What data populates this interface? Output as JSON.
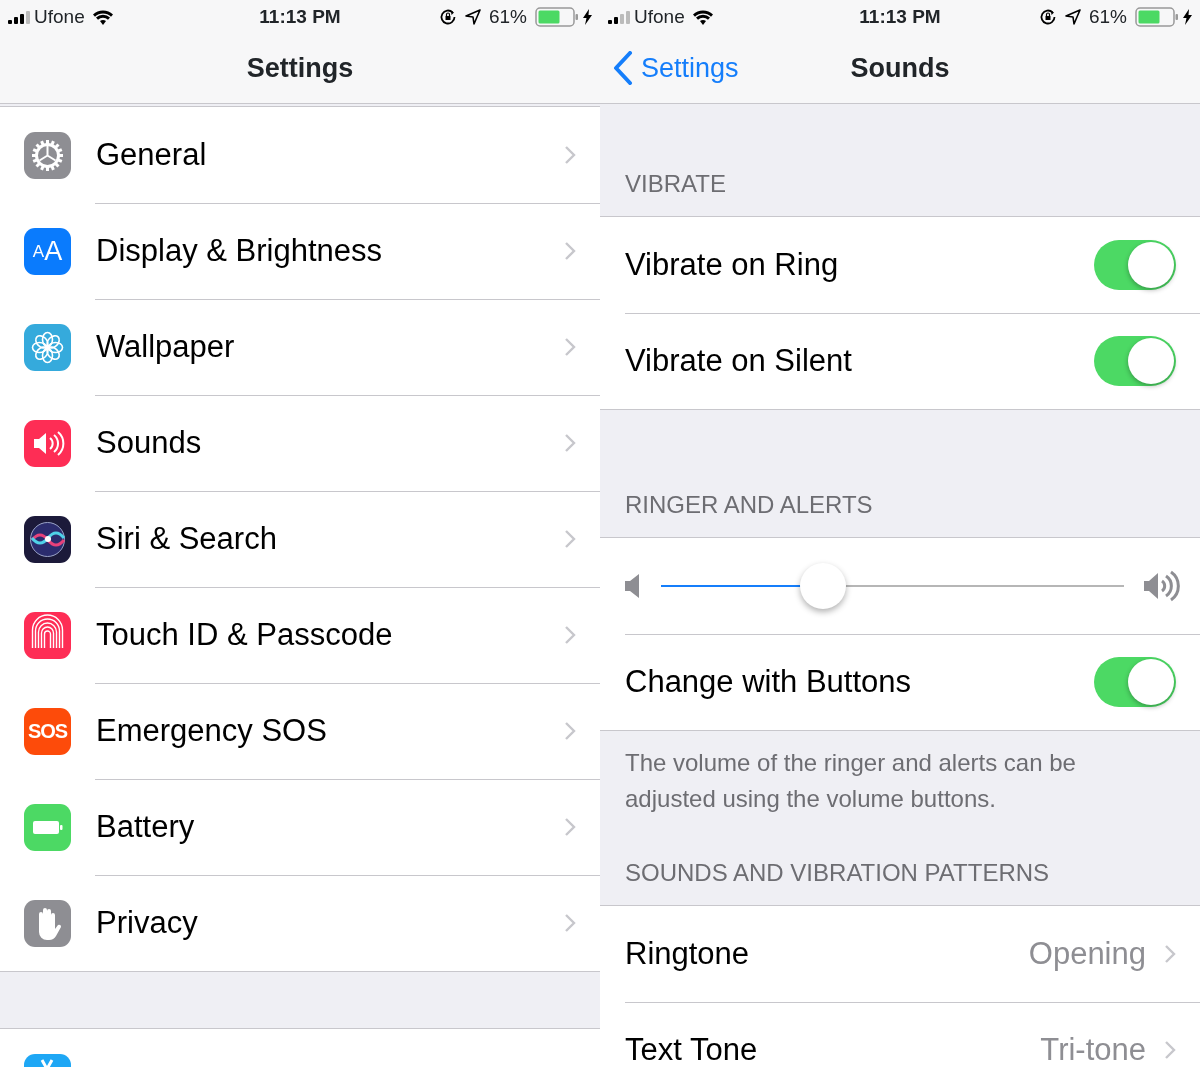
{
  "settings_screen": {
    "status_bar": {
      "carrier": "Ufone",
      "time": "11:13 PM",
      "battery_percent": "61%"
    },
    "nav": {
      "title": "Settings"
    },
    "groups": [
      {
        "rows": [
          {
            "kind": "general",
            "label": "General"
          },
          {
            "kind": "display",
            "label": "Display & Brightness",
            "icon_text": "AA"
          },
          {
            "kind": "wallpaper",
            "label": "Wallpaper"
          },
          {
            "kind": "sounds",
            "label": "Sounds"
          },
          {
            "kind": "siri",
            "label": "Siri & Search"
          },
          {
            "kind": "touchid",
            "label": "Touch ID & Passcode"
          },
          {
            "kind": "sos",
            "label": "Emergency SOS",
            "icon_text": "SOS"
          },
          {
            "kind": "battery",
            "label": "Battery"
          },
          {
            "kind": "privacy",
            "label": "Privacy"
          }
        ]
      },
      {
        "rows": [
          {
            "kind": "store"
          }
        ]
      }
    ]
  },
  "sounds_screen": {
    "status_bar": {
      "carrier": "Ufone",
      "time": "11:13 PM",
      "battery_percent": "61%"
    },
    "nav": {
      "back": "Settings",
      "title": "Sounds"
    },
    "sections": [
      {
        "header": "VIBRATE",
        "rows": [
          {
            "kind": "toggle",
            "label": "Vibrate on Ring",
            "on": true
          },
          {
            "kind": "toggle",
            "label": "Vibrate on Silent",
            "on": true
          }
        ]
      },
      {
        "header": "RINGER AND ALERTS",
        "rows": [
          {
            "kind": "slider",
            "level": 0.35
          },
          {
            "kind": "toggle",
            "label": "Change with Buttons",
            "on": true
          }
        ],
        "footer": "The volume of the ringer and alerts can be adjusted using the volume buttons."
      },
      {
        "header": "SOUNDS AND VIBRATION PATTERNS",
        "rows": [
          {
            "kind": "detail",
            "label": "Ringtone",
            "value": "Opening"
          },
          {
            "kind": "detail",
            "label": "Text Tone",
            "value": "Tri-tone"
          }
        ]
      }
    ]
  }
}
